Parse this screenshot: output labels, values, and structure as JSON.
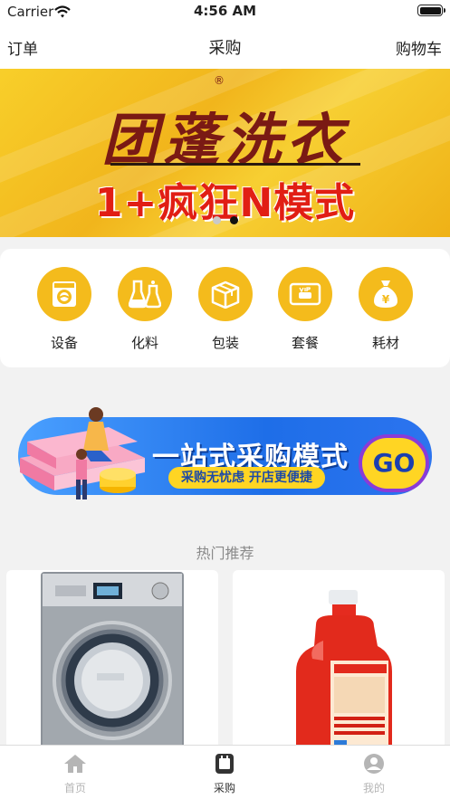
{
  "status_bar": {
    "carrier": "Carrier",
    "time": "4:56 AM"
  },
  "nav": {
    "left": "订单",
    "title": "采购",
    "right": "购物车"
  },
  "hero": {
    "title": "团蓬洗衣",
    "registered": "®",
    "subtitle": "1+疯狂N模式",
    "dots": 2,
    "active_dot": 1
  },
  "categories": [
    {
      "label": "设备",
      "icon": "washing-machine-icon"
    },
    {
      "label": "化料",
      "icon": "chemistry-flask-icon"
    },
    {
      "label": "包装",
      "icon": "package-box-icon"
    },
    {
      "label": "套餐",
      "icon": "vip-card-icon"
    },
    {
      "label": "耗材",
      "icon": "money-bag-icon"
    }
  ],
  "promo": {
    "title": "一站式采购模式",
    "subtitle": "采购无忧虑  开店更便捷",
    "go": "GO"
  },
  "hot": {
    "title": "热门推荐"
  },
  "tabs": [
    {
      "label": "首页",
      "icon": "home-icon",
      "active": false
    },
    {
      "label": "采购",
      "icon": "purchase-icon",
      "active": true
    },
    {
      "label": "我的",
      "icon": "user-icon",
      "active": false
    }
  ],
  "colors": {
    "accent": "#f4bb1c",
    "tab_inactive": "#b5b5b5",
    "tab_active": "#333333"
  }
}
